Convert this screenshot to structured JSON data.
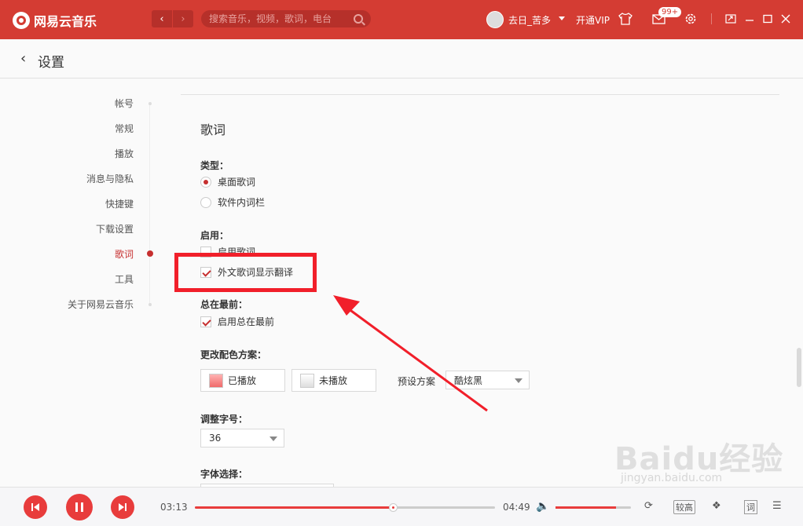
{
  "app": {
    "brand": "网易云音乐"
  },
  "titlebar": {
    "search_placeholder": "搜索音乐，视频，歌词，电台",
    "username": "去日_苦多",
    "vip_label": "开通VIP",
    "mail_badge": "99+"
  },
  "header": {
    "title": "设置"
  },
  "sidebar": {
    "items": [
      {
        "label": "帐号"
      },
      {
        "label": "常规"
      },
      {
        "label": "播放"
      },
      {
        "label": "消息与隐私"
      },
      {
        "label": "快捷键"
      },
      {
        "label": "下载设置"
      },
      {
        "label": "歌词"
      },
      {
        "label": "工具"
      },
      {
        "label": "关于网易云音乐"
      }
    ],
    "active_index": 6
  },
  "lyrics": {
    "section_title": "歌词",
    "type_label": "类型：",
    "type_options": [
      {
        "label": "桌面歌词",
        "selected": true
      },
      {
        "label": "软件内词栏",
        "selected": false
      }
    ],
    "enable_label": "启用：",
    "enable_options": [
      {
        "label": "启用歌词",
        "checked": false
      },
      {
        "label": "外文歌词显示翻译",
        "checked": true
      }
    ],
    "ontop_label": "总在最前：",
    "ontop_option": {
      "label": "启用总在最前",
      "checked": true
    },
    "color_label": "更改配色方案：",
    "played_label": "已播放",
    "unplayed_label": "未播放",
    "preset_label": "预设方案",
    "preset_value": "酷炫黑",
    "fontsize_label": "调整字号：",
    "fontsize_value": "36",
    "font_label": "字体选择："
  },
  "player": {
    "current_time": "03:13",
    "total_time": "04:49",
    "progress": 0.66,
    "volume": 0.8,
    "quality_label": "较高",
    "lyric_button": "词"
  },
  "watermark": {
    "text": "Baidu经验",
    "sub": "jingyan.baidu.com"
  },
  "colors": {
    "brand": "#d43c33",
    "accent": "#c62f2f",
    "annotation": "#f11f2a"
  }
}
